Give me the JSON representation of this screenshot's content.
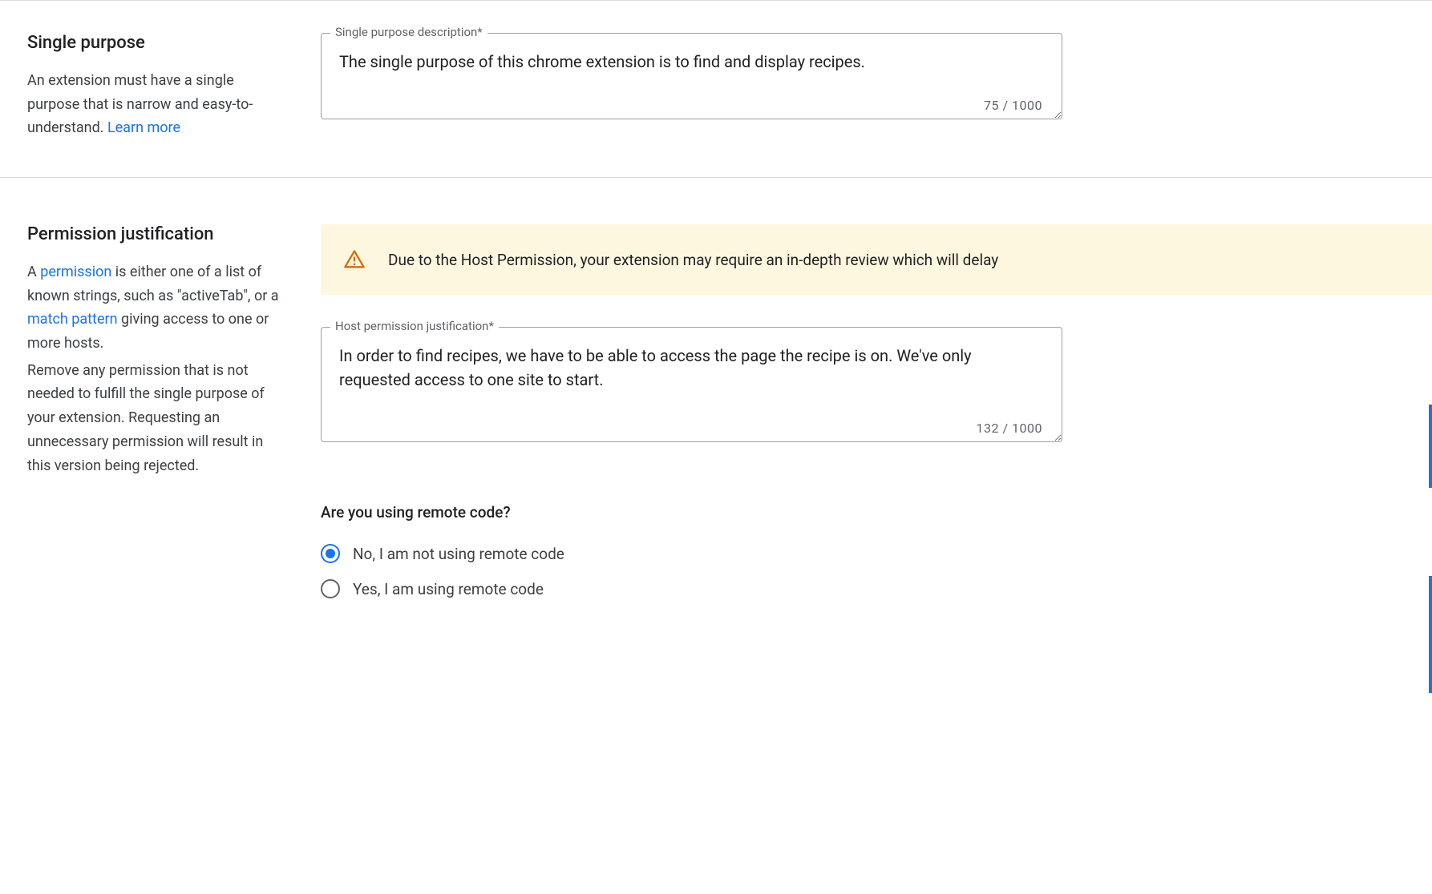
{
  "singlePurpose": {
    "title": "Single purpose",
    "descParts": {
      "p1": "An extension must have a single purpose that is narrow and easy-to-understand. ",
      "link": "Learn more"
    },
    "field": {
      "label": "Single purpose description*",
      "value": "The single purpose of this chrome extension is to find and display recipes.",
      "counter": "75 / 1000"
    }
  },
  "permissionJustification": {
    "title": "Permission justification",
    "descParts": {
      "p1": "A ",
      "link1": "permission",
      "p2": " is either one of a list of known strings, such as \"activeTab\", or a ",
      "link2": "match pattern",
      "p3": " giving access to one or more hosts.",
      "para2": "Remove any permission that is not needed to fulfill the single purpose of your extension. Requesting an unnecessary permission will result in this version being rejected."
    },
    "warning": "Due to the Host Permission, your extension may require an in-depth review which will delay",
    "field": {
      "label": "Host permission justification*",
      "value": "In order to find recipes, we have to be able to access the page the recipe is on. We've only requested access to one site to start.",
      "counter": "132 / 1000"
    },
    "remoteCode": {
      "question": "Are you using remote code?",
      "optionNo": "No, I am not using remote code",
      "optionYes": "Yes, I am using remote code"
    }
  }
}
